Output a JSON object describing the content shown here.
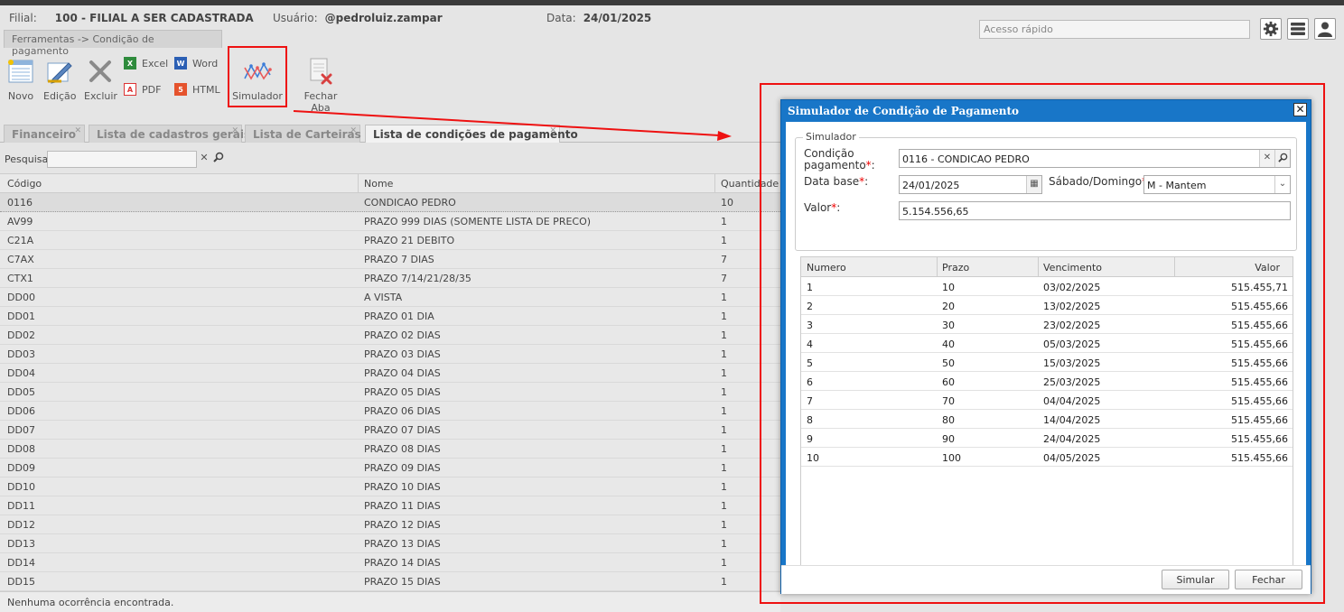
{
  "header": {
    "filial_label": "Filial:",
    "filial_value": "100 - FILIAL A SER CADASTRADA",
    "usuario_label": "Usuário:",
    "usuario_value": "@pedroluiz.zampar",
    "data_label": "Data:",
    "data_value": "24/01/2025",
    "quick_access_placeholder": "Acesso rápido"
  },
  "breadcrumb": "Ferramentas -> Condição de pagamento",
  "toolbar": {
    "novo": "Novo",
    "edicao": "Edição",
    "excluir": "Excluir",
    "excel": "Excel",
    "word": "Word",
    "pdf": "PDF",
    "html": "HTML",
    "simulador": "Simulador",
    "fechar_aba": "Fechar Aba"
  },
  "tabs": [
    {
      "label": "Financeiro"
    },
    {
      "label": "Lista de cadastros gerais"
    },
    {
      "label": "Lista de Carteiras"
    },
    {
      "label": "Lista de condições de pagamento"
    }
  ],
  "search": {
    "label": "Pesquisar"
  },
  "grid": {
    "columns": [
      "Código",
      "Nome",
      "Quantidade P"
    ],
    "rows": [
      [
        "0116",
        "CONDICAO PEDRO",
        "10"
      ],
      [
        "AV99",
        "PRAZO 999 DIAS (SOMENTE LISTA DE PRECO)",
        "1"
      ],
      [
        "C21A",
        "PRAZO 21 DEBITO",
        "1"
      ],
      [
        "C7AX",
        "PRAZO 7 DIAS",
        "7"
      ],
      [
        "CTX1",
        "PRAZO 7/14/21/28/35",
        "7"
      ],
      [
        "DD00",
        "A VISTA",
        "1"
      ],
      [
        "DD01",
        "PRAZO 01 DIA",
        "1"
      ],
      [
        "DD02",
        "PRAZO 02 DIAS",
        "1"
      ],
      [
        "DD03",
        "PRAZO 03 DIAS",
        "1"
      ],
      [
        "DD04",
        "PRAZO 04 DIAS",
        "1"
      ],
      [
        "DD05",
        "PRAZO 05 DIAS",
        "1"
      ],
      [
        "DD06",
        "PRAZO 06 DIAS",
        "1"
      ],
      [
        "DD07",
        "PRAZO 07 DIAS",
        "1"
      ],
      [
        "DD08",
        "PRAZO 08 DIAS",
        "1"
      ],
      [
        "DD09",
        "PRAZO 09 DIAS",
        "1"
      ],
      [
        "DD10",
        "PRAZO 10 DIAS",
        "1"
      ],
      [
        "DD11",
        "PRAZO 11 DIAS",
        "1"
      ],
      [
        "DD12",
        "PRAZO 12 DIAS",
        "1"
      ],
      [
        "DD13",
        "PRAZO 13 DIAS",
        "1"
      ],
      [
        "DD14",
        "PRAZO 14 DIAS",
        "1"
      ],
      [
        "DD15",
        "PRAZO 15 DIAS",
        "1"
      ]
    ],
    "footer": "Nenhuma ocorrência encontrada."
  },
  "dialog": {
    "title": "Simulador de Condição de Pagamento",
    "fieldset_legend": "Simulador",
    "condicao_label_1": "Condição",
    "condicao_label_2": "pagamento",
    "condicao_value": "0116 - CONDICAO PEDRO",
    "data_base_label": "Data base",
    "data_base_value": "24/01/2025",
    "sabado_label": "Sábado/Domingo",
    "sabado_value": "M - Mantem",
    "valor_label": "Valor",
    "valor_value": "5.154.556,65",
    "required_mark": "*",
    "colon": ":",
    "columns": [
      "Numero",
      "Prazo",
      "Vencimento",
      "Valor"
    ],
    "rows": [
      [
        "1",
        "10",
        "03/02/2025",
        "515.455,71"
      ],
      [
        "2",
        "20",
        "13/02/2025",
        "515.455,66"
      ],
      [
        "3",
        "30",
        "23/02/2025",
        "515.455,66"
      ],
      [
        "4",
        "40",
        "05/03/2025",
        "515.455,66"
      ],
      [
        "5",
        "50",
        "15/03/2025",
        "515.455,66"
      ],
      [
        "6",
        "60",
        "25/03/2025",
        "515.455,66"
      ],
      [
        "7",
        "70",
        "04/04/2025",
        "515.455,66"
      ],
      [
        "8",
        "80",
        "14/04/2025",
        "515.455,66"
      ],
      [
        "9",
        "90",
        "24/04/2025",
        "515.455,66"
      ],
      [
        "10",
        "100",
        "04/05/2025",
        "515.455,66"
      ]
    ],
    "simular_button": "Simular",
    "fechar_button": "Fechar"
  },
  "colors": {
    "dialog_blue": "#1876c8",
    "highlight_red": "#ee1111"
  }
}
